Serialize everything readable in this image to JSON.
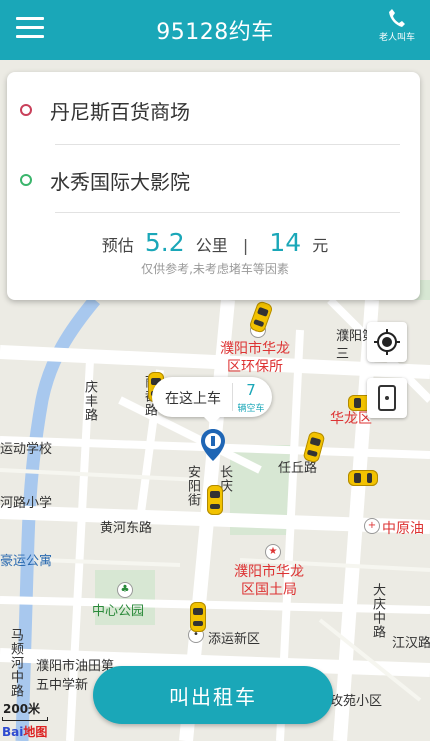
{
  "header": {
    "title": "95128约车",
    "elder_call_label": "老人叫车"
  },
  "route": {
    "origin": "丹尼斯百货商场",
    "destination": "水秀国际大影院",
    "estimate_prefix": "预估",
    "distance_value": "5.2",
    "distance_unit": "公里",
    "separator": "|",
    "price_value": "14",
    "price_unit": "元",
    "note": "仅供参考,未考虑堵车等因素"
  },
  "pickup": {
    "label": "在这上车",
    "count": "7",
    "count_unit": "辆空车"
  },
  "call_button": "叫出租车",
  "map": {
    "scale": "200米",
    "logo_prefix": "Bai",
    "logo_suffix": "地图",
    "labels": {
      "huanbao": "濮阳市华龙\n区环保所",
      "guotu": "濮阳市华龙\n区国土局",
      "puyang_di": "濮阳第\n三",
      "huanglong_qu": "华龙区",
      "qingfeng_lu": "庆丰路",
      "lidu_lu": "丽都路",
      "renqiu_lu": "任丘路",
      "anyang_jie": "安阳街",
      "changqing": "长庆",
      "huanghe_donglu": "黄河东路",
      "zhongyuan_you": "中原油",
      "yundong_xuexiao": "运动学校",
      "lu_xiaoxue": "河路小学",
      "hao_gongyu": "豪运公寓",
      "zhongxin_gongyuan": "中心公园",
      "tianyun_xinqu": "添运新区",
      "jiangxia_lu": "江汉路",
      "daqing_zhonglu": "大庆中路",
      "madian_zhonglu": "马颊河中路",
      "youtian_zhongxue": "濮阳市油田第\n五中学新",
      "meiyuan_xiaoqu": "玫苑小区"
    }
  },
  "colors": {
    "primary": "#1aa7b8",
    "origin_dot": "#c9405a",
    "dest_dot": "#3bb56c",
    "taxi": "#f2c200"
  }
}
